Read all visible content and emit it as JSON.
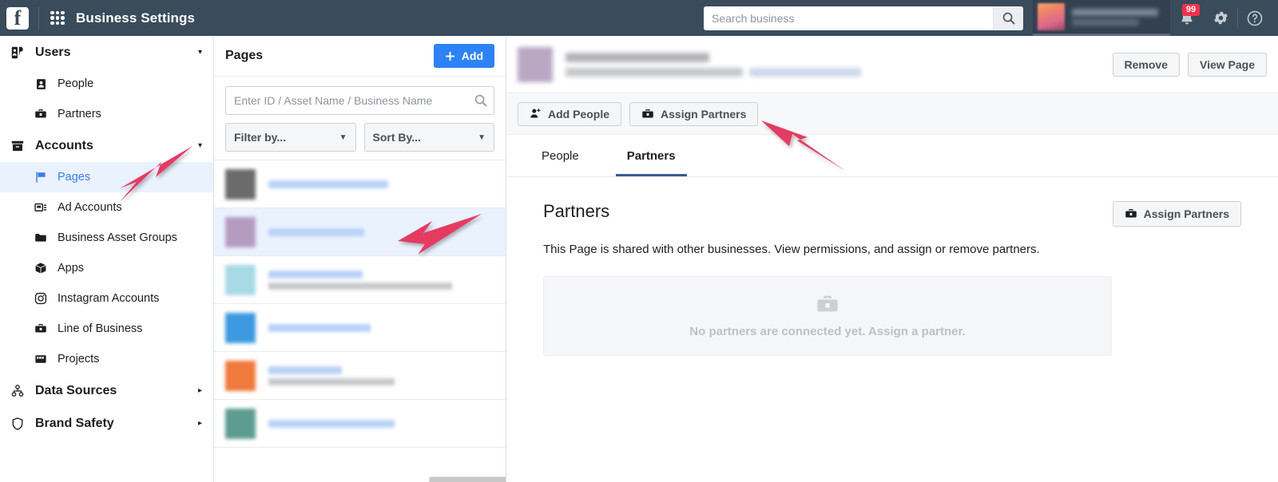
{
  "topbar": {
    "logo_letter": "f",
    "title": "Business Settings",
    "search": {
      "placeholder": "Search business",
      "value": ""
    },
    "notifications_badge": "99"
  },
  "sidebar": {
    "groups": [
      {
        "label": "Users",
        "icon": "users-icon",
        "caret": "▾",
        "expanded": true,
        "items": [
          {
            "label": "People",
            "icon": "person-icon",
            "selected": false
          },
          {
            "label": "Partners",
            "icon": "briefcase-icon",
            "selected": false
          }
        ]
      },
      {
        "label": "Accounts",
        "icon": "box-icon",
        "caret": "▾",
        "expanded": true,
        "items": [
          {
            "label": "Pages",
            "icon": "flag-icon",
            "selected": true
          },
          {
            "label": "Ad Accounts",
            "icon": "adaccount-icon",
            "selected": false
          },
          {
            "label": "Business Asset Groups",
            "icon": "folder-icon",
            "selected": false
          },
          {
            "label": "Apps",
            "icon": "app-icon",
            "selected": false
          },
          {
            "label": "Instagram Accounts",
            "icon": "instagram-icon",
            "selected": false
          },
          {
            "label": "Line of Business",
            "icon": "briefcase-icon",
            "selected": false
          },
          {
            "label": "Projects",
            "icon": "projects-icon",
            "selected": false
          }
        ]
      },
      {
        "label": "Data Sources",
        "icon": "datasources-icon",
        "caret": "▸",
        "expanded": false,
        "items": []
      },
      {
        "label": "Brand Safety",
        "icon": "shield-icon",
        "caret": "▸",
        "expanded": false,
        "items": []
      }
    ]
  },
  "pages_column": {
    "title": "Pages",
    "add_button": {
      "label": "Add",
      "icon": "plus-icon",
      "color": "#2d82f5"
    },
    "search": {
      "placeholder": "Enter ID / Asset Name / Business Name",
      "value": "",
      "icon": "search-icon"
    },
    "filter_select": {
      "label": "Filter by...",
      "icon": "chevron-down-icon"
    },
    "sort_select": {
      "label": "Sort By...",
      "icon": "chevron-down-icon"
    },
    "rows": [
      {
        "redacted": true,
        "thumb_color": "#6b6b6b",
        "selected": false,
        "line1_w": 150,
        "line2_w": 0
      },
      {
        "redacted": true,
        "thumb_color": "#b49cc0",
        "selected": true,
        "line1_w": 120,
        "line2_w": 0
      },
      {
        "redacted": true,
        "thumb_color": "#a8dae6",
        "selected": false,
        "line1_w": 118,
        "line2_w": 230
      },
      {
        "redacted": true,
        "thumb_color": "#3d9ae0",
        "selected": false,
        "line1_w": 128,
        "line2_w": 0
      },
      {
        "redacted": true,
        "thumb_color": "#ef7a3c",
        "selected": false,
        "line1_w": 92,
        "line2_w": 158
      },
      {
        "redacted": true,
        "thumb_color": "#5e9c91",
        "selected": false,
        "line1_w": 158,
        "line2_w": 0
      }
    ]
  },
  "right_panel": {
    "asset": {
      "redacted": true
    },
    "header_buttons": [
      {
        "label": "Remove",
        "name": "remove-button"
      },
      {
        "label": "View Page",
        "name": "view-page-button"
      }
    ],
    "action_buttons": [
      {
        "label": "Add People",
        "icon": "add-person-icon",
        "name": "add-people-button"
      },
      {
        "label": "Assign Partners",
        "icon": "briefcase-icon",
        "name": "assign-partners-button"
      }
    ],
    "tabs": [
      {
        "label": "People",
        "active": false
      },
      {
        "label": "Partners",
        "active": true
      }
    ],
    "section": {
      "title": "Partners",
      "description": "This Page is shared with other businesses. View permissions, and assign or remove partners.",
      "assign_button": {
        "label": "Assign Partners",
        "icon": "briefcase-icon"
      },
      "empty_state": {
        "icon": "briefcase-icon",
        "text": "No partners are connected yet. Assign a partner."
      }
    }
  },
  "annotations": {
    "arrow_color": "#e43a63",
    "arrows": [
      {
        "name": "arrow-to-pages-sidebar-item",
        "target": "Pages"
      },
      {
        "name": "arrow-to-selected-page-row",
        "target": "selected page row"
      },
      {
        "name": "arrow-to-assign-partners-button",
        "target": "Assign Partners"
      }
    ]
  }
}
